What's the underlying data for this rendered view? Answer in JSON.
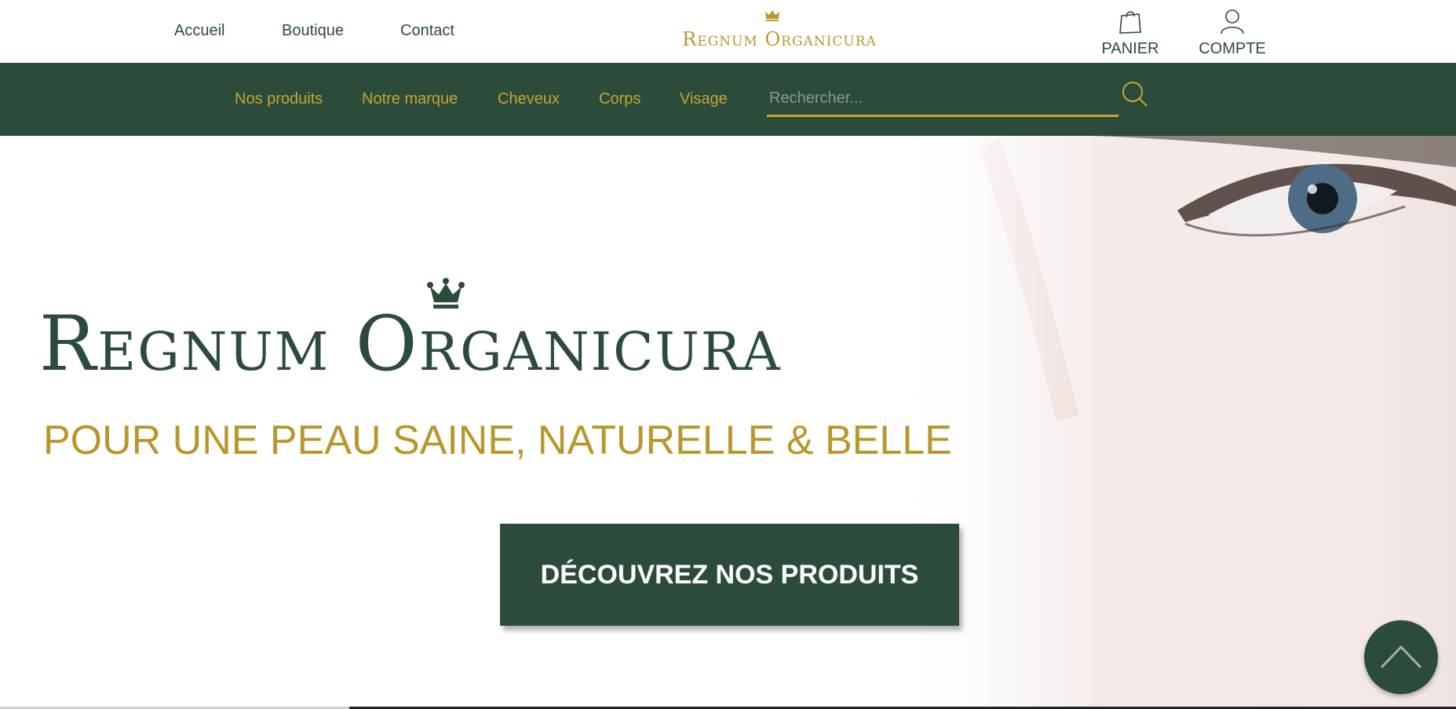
{
  "header": {
    "nav": [
      "Accueil",
      "Boutique",
      "Contact"
    ],
    "logo_text": "Regnum Organicura",
    "cart_label": "PANIER",
    "account_label": "COMPTE"
  },
  "category_nav": {
    "items": [
      "Nos produits",
      "Notre marque",
      "Cheveux",
      "Corps",
      "Visage"
    ],
    "search_placeholder": "Rechercher..."
  },
  "hero": {
    "brand_title": "Regnum Organicura",
    "tagline": "POUR UNE PEAU SAINE, NATURELLE & BELLE",
    "cta_label": "DÉCOUVREZ NOS PRODUITS"
  },
  "icons": {
    "crown": "crown-icon",
    "cart": "shopping-bag-icon",
    "account": "user-icon",
    "search": "search-icon",
    "scroll_top": "chevron-up-icon"
  },
  "colors": {
    "brand_green": "#2b4c3b",
    "brand_gold": "#b8972b",
    "nav_gold": "#c7a52f"
  }
}
